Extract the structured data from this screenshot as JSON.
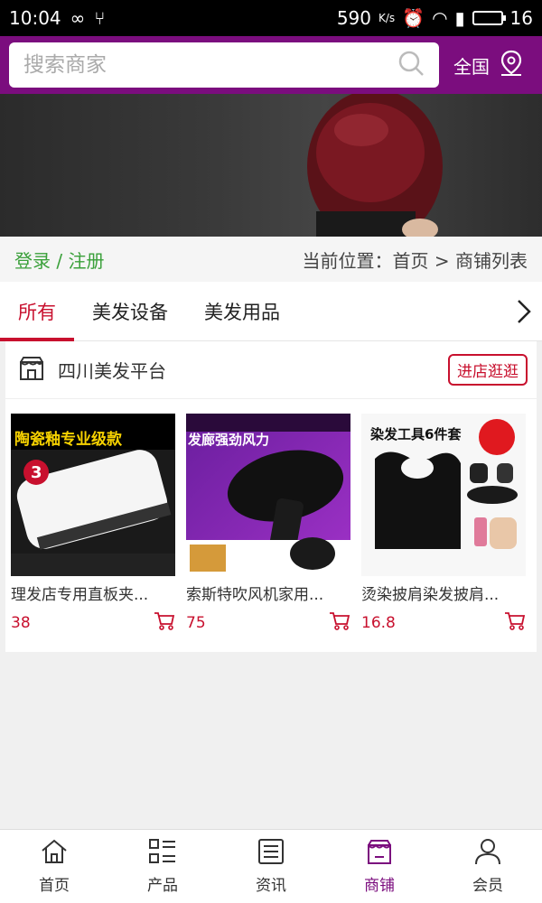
{
  "status": {
    "time": "10:04",
    "speed": "590",
    "speed_unit": "K/s",
    "battery": "16"
  },
  "search": {
    "placeholder": "搜索商家"
  },
  "region": {
    "label": "全国"
  },
  "location": {
    "login": "登录 / 注册",
    "breadcrumb": "当前位置：首页 > 商铺列表"
  },
  "tabs": [
    {
      "label": "所有",
      "active": true
    },
    {
      "label": "美发设备",
      "active": false
    },
    {
      "label": "美发用品",
      "active": false
    }
  ],
  "shop": {
    "name": "四川美发平台",
    "enter_label": "进店逛逛",
    "products": [
      {
        "name": "理发店专用直板夹...",
        "price": "38",
        "img_text": "陶瓷釉专业级款"
      },
      {
        "name": "索斯特吹风机家用...",
        "price": "75",
        "img_text": "发廊强劲风力"
      },
      {
        "name": "烫染披肩染发披肩...",
        "price": "16.8",
        "img_text": "染发工具6件套"
      }
    ]
  },
  "nav": [
    {
      "label": "首页",
      "icon": "home-icon"
    },
    {
      "label": "产品",
      "icon": "grid-list-icon"
    },
    {
      "label": "资讯",
      "icon": "news-icon"
    },
    {
      "label": "商铺",
      "icon": "shop-icon",
      "active": true
    },
    {
      "label": "会员",
      "icon": "user-icon"
    }
  ],
  "colors": {
    "brand": "#7b0d7e",
    "accent": "#c8102e",
    "login": "#3aa03a"
  }
}
